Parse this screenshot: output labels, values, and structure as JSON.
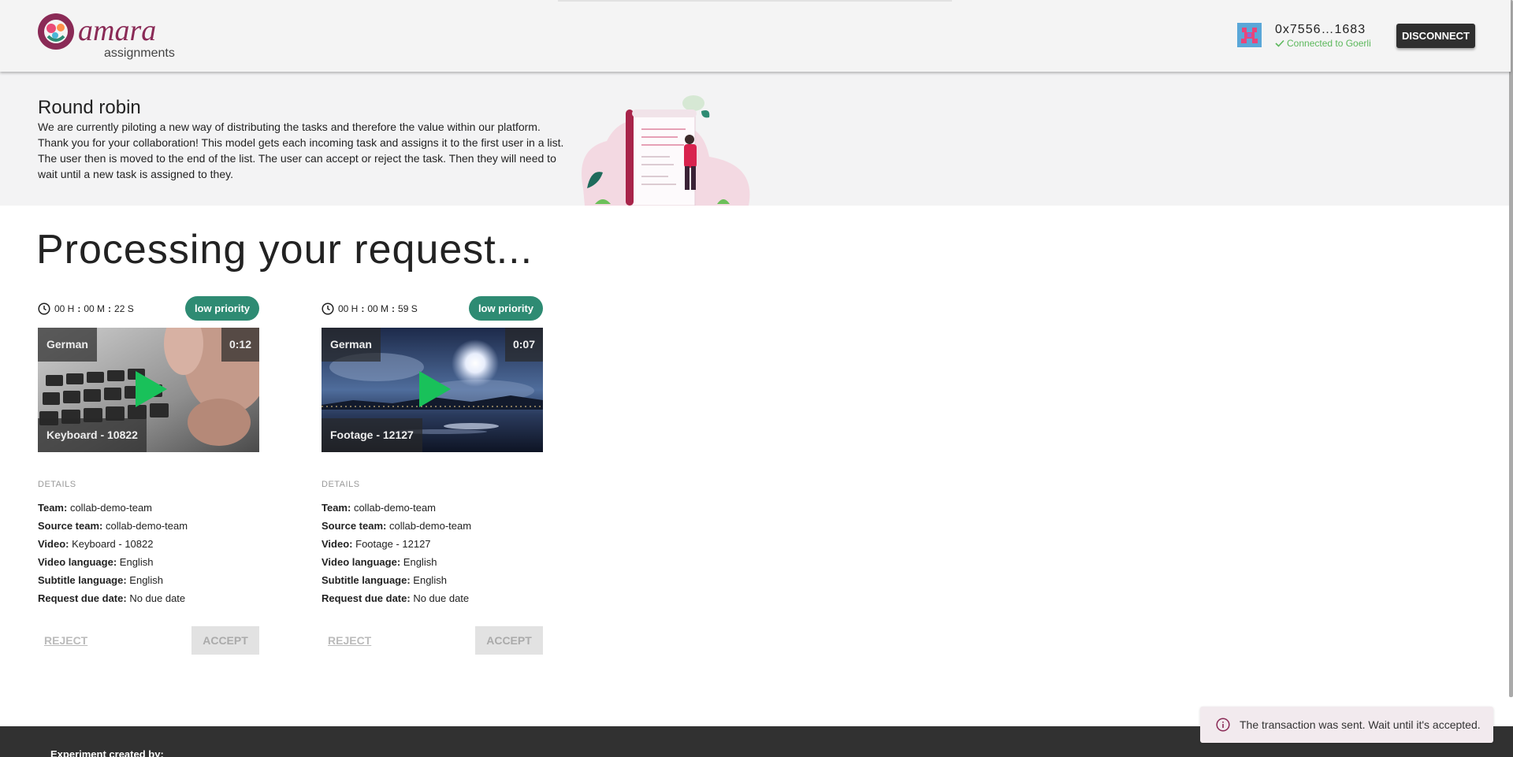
{
  "header": {
    "logo_text": "amara",
    "logo_subtitle": "assignments",
    "wallet_address": "0x7556…1683",
    "connection_status": "Connected to Goerli",
    "disconnect_label": "DISCONNECT"
  },
  "banner": {
    "title": "Round robin",
    "description": "We are currently piloting a new way of distributing the tasks and therefore the value within our platform. Thank you for your collaboration! This model gets each incoming task and assigns it to the first user in a list. The user then is moved to the end of the list. The user can accept or reject the task. Then they will need to wait until a new task is assigned to they."
  },
  "main": {
    "heading": "Processing your request..."
  },
  "tasks": [
    {
      "timer": {
        "h": "00 H",
        "m": "00 M",
        "s": "22 S"
      },
      "priority": "low priority",
      "video": {
        "language": "German",
        "duration": "0:12",
        "title": "Keyboard - 10822"
      },
      "details_label": "DETAILS",
      "details": {
        "team_label": "Team:",
        "team": "collab-demo-team",
        "source_team_label": "Source team:",
        "source_team": "collab-demo-team",
        "video_label": "Video:",
        "video": "Keyboard - 10822",
        "video_language_label": "Video language:",
        "video_language": "English",
        "subtitle_language_label": "Subtitle language:",
        "subtitle_language": "English",
        "due_date_label": "Request due date:",
        "due_date": "No due date"
      },
      "reject_label": "REJECT",
      "accept_label": "ACCEPT"
    },
    {
      "timer": {
        "h": "00 H",
        "m": "00 M",
        "s": "59 S"
      },
      "priority": "low priority",
      "video": {
        "language": "German",
        "duration": "0:07",
        "title": "Footage - 12127"
      },
      "details_label": "DETAILS",
      "details": {
        "team_label": "Team:",
        "team": "collab-demo-team",
        "source_team_label": "Source team:",
        "source_team": "collab-demo-team",
        "video_label": "Video:",
        "video": "Footage - 12127",
        "video_language_label": "Video language:",
        "video_language": "English",
        "subtitle_language_label": "Subtitle language:",
        "subtitle_language": "English",
        "due_date_label": "Request due date:",
        "due_date": "No due date"
      },
      "reject_label": "REJECT",
      "accept_label": "ACCEPT"
    }
  ],
  "footer": {
    "text": "Experiment created by:"
  },
  "toast": {
    "message": "The transaction was sent. Wait until it's accepted.",
    "icon": "info-icon"
  },
  "colors": {
    "brand": "#8a2a56",
    "priority_badge": "#2e8b73",
    "play_icon": "#19c15a",
    "connected": "#5cb85c"
  }
}
